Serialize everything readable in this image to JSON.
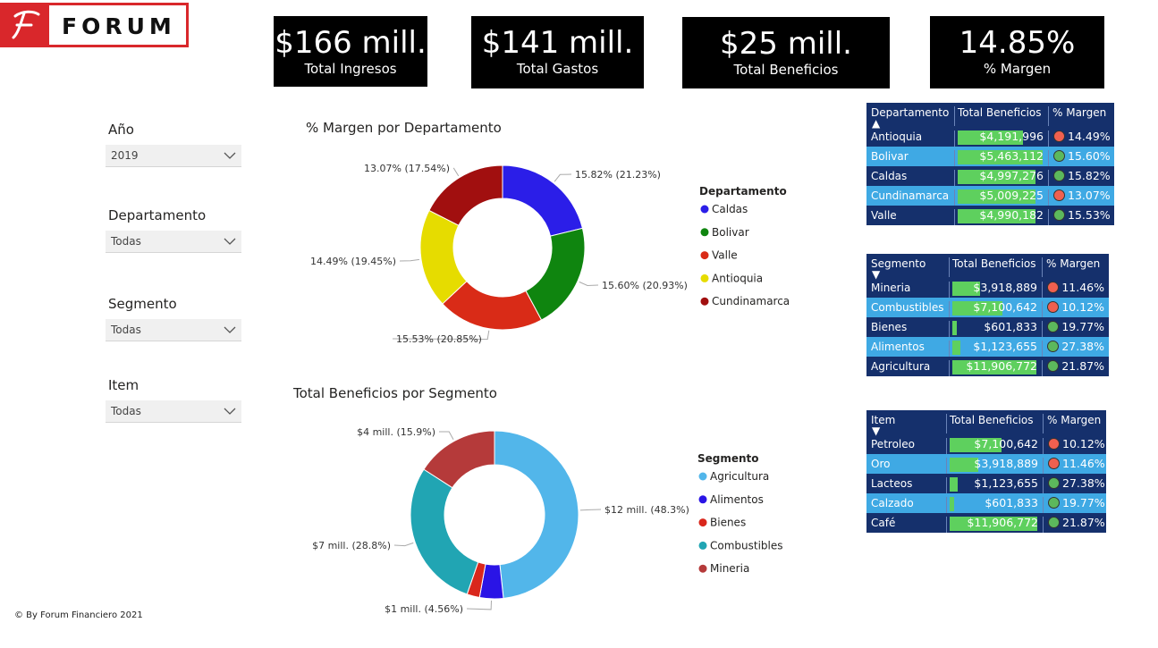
{
  "logo": {
    "text": "FORUM",
    "mark": "F"
  },
  "kpis": [
    {
      "value": "$166 mill.",
      "label": "Total Ingresos"
    },
    {
      "value": "$141 mill.",
      "label": "Total Gastos"
    },
    {
      "value": "$25 mill.",
      "label": "Total Beneficios"
    },
    {
      "value": "14.85%",
      "label": "% Margen"
    }
  ],
  "slicers": [
    {
      "label": "Año",
      "value": "2019"
    },
    {
      "label": "Departamento",
      "value": "Todas"
    },
    {
      "label": "Segmento",
      "value": "Todas"
    },
    {
      "label": "Item",
      "value": "Todas"
    }
  ],
  "chart_data": [
    {
      "type": "pie",
      "title": "% Margen por Departamento",
      "legend_title": "Departamento",
      "legend_position": "right",
      "categories": [
        "Caldas",
        "Bolivar",
        "Valle",
        "Antioquia",
        "Cundinamarca"
      ],
      "values": [
        15.82,
        15.6,
        15.53,
        14.49,
        13.07
      ],
      "shares": [
        21.23,
        20.93,
        20.85,
        19.45,
        17.54
      ],
      "labels": [
        "15.82% (21.23%)",
        "15.60% (20.93%)",
        "15.53% (20.85%)",
        "14.49% (19.45%)",
        "13.07% (17.54%)"
      ],
      "colors": [
        "#2b1ee8",
        "#0f850f",
        "#d92b17",
        "#e6dc00",
        "#a10f0f"
      ]
    },
    {
      "type": "pie",
      "title": "Total Beneficios por Segmento",
      "legend_title": "Segmento",
      "legend_position": "right",
      "categories": [
        "Agricultura",
        "Alimentos",
        "Bienes",
        "Combustibles",
        "Mineria"
      ],
      "values": [
        11906772,
        1123655,
        601833,
        7100642,
        3918889
      ],
      "shares": [
        48.3,
        4.56,
        2.44,
        28.8,
        15.9
      ],
      "labels": [
        "$12 mill. (48.3%)",
        "$1 mill. (4.56%)",
        "",
        "$7 mill. (28.8%)",
        "$4 mill. (15.9%)"
      ],
      "colors": [
        "#52b6ea",
        "#2a14e6",
        "#d9271c",
        "#21a5b3",
        "#b53a3a"
      ]
    }
  ],
  "tables": [
    {
      "headers": [
        "Departamento",
        "Total Beneficios",
        "% Margen"
      ],
      "sort_icon": "sort-up-icon",
      "rows": [
        {
          "name": "Antioquia",
          "value": "$4,191,996",
          "num": 4191996,
          "margin": "14.49%",
          "status": "red"
        },
        {
          "name": "Bolivar",
          "value": "$5,463,112",
          "num": 5463112,
          "margin": "15.60%",
          "status": "green"
        },
        {
          "name": "Caldas",
          "value": "$4,997,276",
          "num": 4997276,
          "margin": "15.82%",
          "status": "green"
        },
        {
          "name": "Cundinamarca",
          "value": "$5,009,225",
          "num": 5009225,
          "margin": "13.07%",
          "status": "red"
        },
        {
          "name": "Valle",
          "value": "$4,990,182",
          "num": 4990182,
          "margin": "15.53%",
          "status": "green"
        }
      ]
    },
    {
      "headers": [
        "Segmento",
        "Total Beneficios",
        "% Margen"
      ],
      "sort_icon": "sort-down-icon",
      "rows": [
        {
          "name": "Mineria",
          "value": "$3,918,889",
          "num": 3918889,
          "margin": "11.46%",
          "status": "red"
        },
        {
          "name": "Combustibles",
          "value": "$7,100,642",
          "num": 7100642,
          "margin": "10.12%",
          "status": "red"
        },
        {
          "name": "Bienes",
          "value": "$601,833",
          "num": 601833,
          "margin": "19.77%",
          "status": "green"
        },
        {
          "name": "Alimentos",
          "value": "$1,123,655",
          "num": 1123655,
          "margin": "27.38%",
          "status": "green"
        },
        {
          "name": "Agricultura",
          "value": "$11,906,772",
          "num": 11906772,
          "margin": "21.87%",
          "status": "green"
        }
      ]
    },
    {
      "headers": [
        "Item",
        "Total Beneficios",
        "% Margen"
      ],
      "sort_icon": "sort-down-icon",
      "rows": [
        {
          "name": "Petroleo",
          "value": "$7,100,642",
          "num": 7100642,
          "margin": "10.12%",
          "status": "red"
        },
        {
          "name": "Oro",
          "value": "$3,918,889",
          "num": 3918889,
          "margin": "11.46%",
          "status": "red"
        },
        {
          "name": "Lacteos",
          "value": "$1,123,655",
          "num": 1123655,
          "margin": "27.38%",
          "status": "green"
        },
        {
          "name": "Calzado",
          "value": "$601,833",
          "num": 601833,
          "margin": "19.77%",
          "status": "green"
        },
        {
          "name": "Café",
          "value": "$11,906,772",
          "num": 11906772,
          "margin": "21.87%",
          "status": "green"
        }
      ]
    }
  ],
  "status_colors": {
    "red": "#f0604f",
    "green": "#5cb85c"
  },
  "footer": "© By Forum Financiero 2021"
}
